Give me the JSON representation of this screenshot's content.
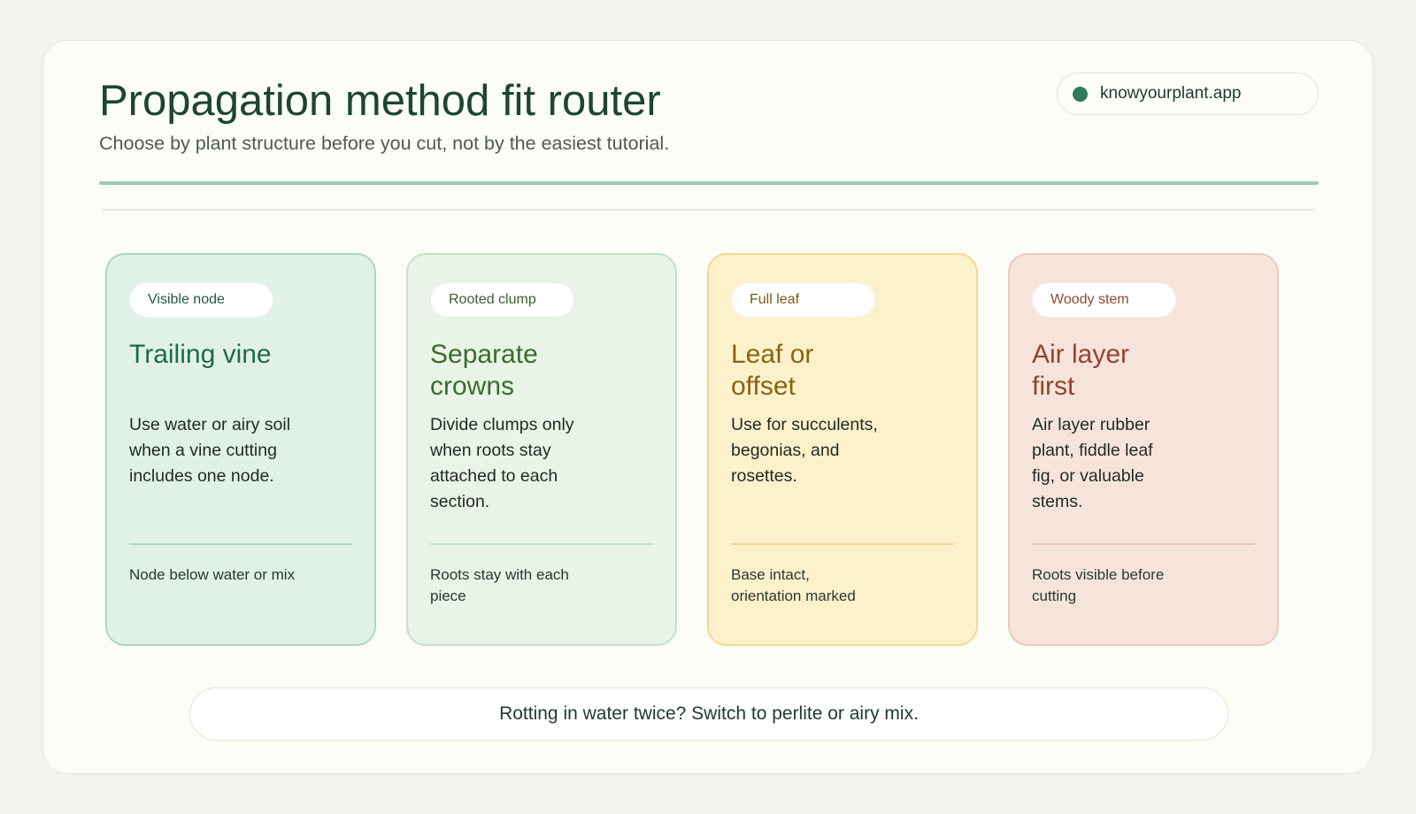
{
  "header": {
    "title": "Propagation method fit router",
    "subtitle": "Choose by plant structure before you cut, not by the easiest tutorial.",
    "site": "knowyourplant.app"
  },
  "colors": {
    "accent": "#2e7a5b",
    "accent_rule": "#9ccbb2"
  },
  "cards": [
    {
      "tag": "Visible node",
      "title": "Trailing vine",
      "body": "Use water or airy soil when a vine cutting includes one node.",
      "check": "Node below water or mix"
    },
    {
      "tag": "Rooted clump",
      "title": "Separate crowns",
      "body": "Divide clumps only when roots stay attached to each section.",
      "check": "Roots stay with each piece"
    },
    {
      "tag": "Full leaf",
      "title": "Leaf or offset",
      "body": "Use for succulents, begonias, and rosettes.",
      "check": "Base intact, orientation marked"
    },
    {
      "tag": "Woody stem",
      "title": "Air layer first",
      "body": "Air layer rubber plant, fiddle leaf fig, or valuable stems.",
      "check": "Roots visible before cutting"
    }
  ],
  "tip": "Rotting in water twice? Switch to perlite or airy mix."
}
